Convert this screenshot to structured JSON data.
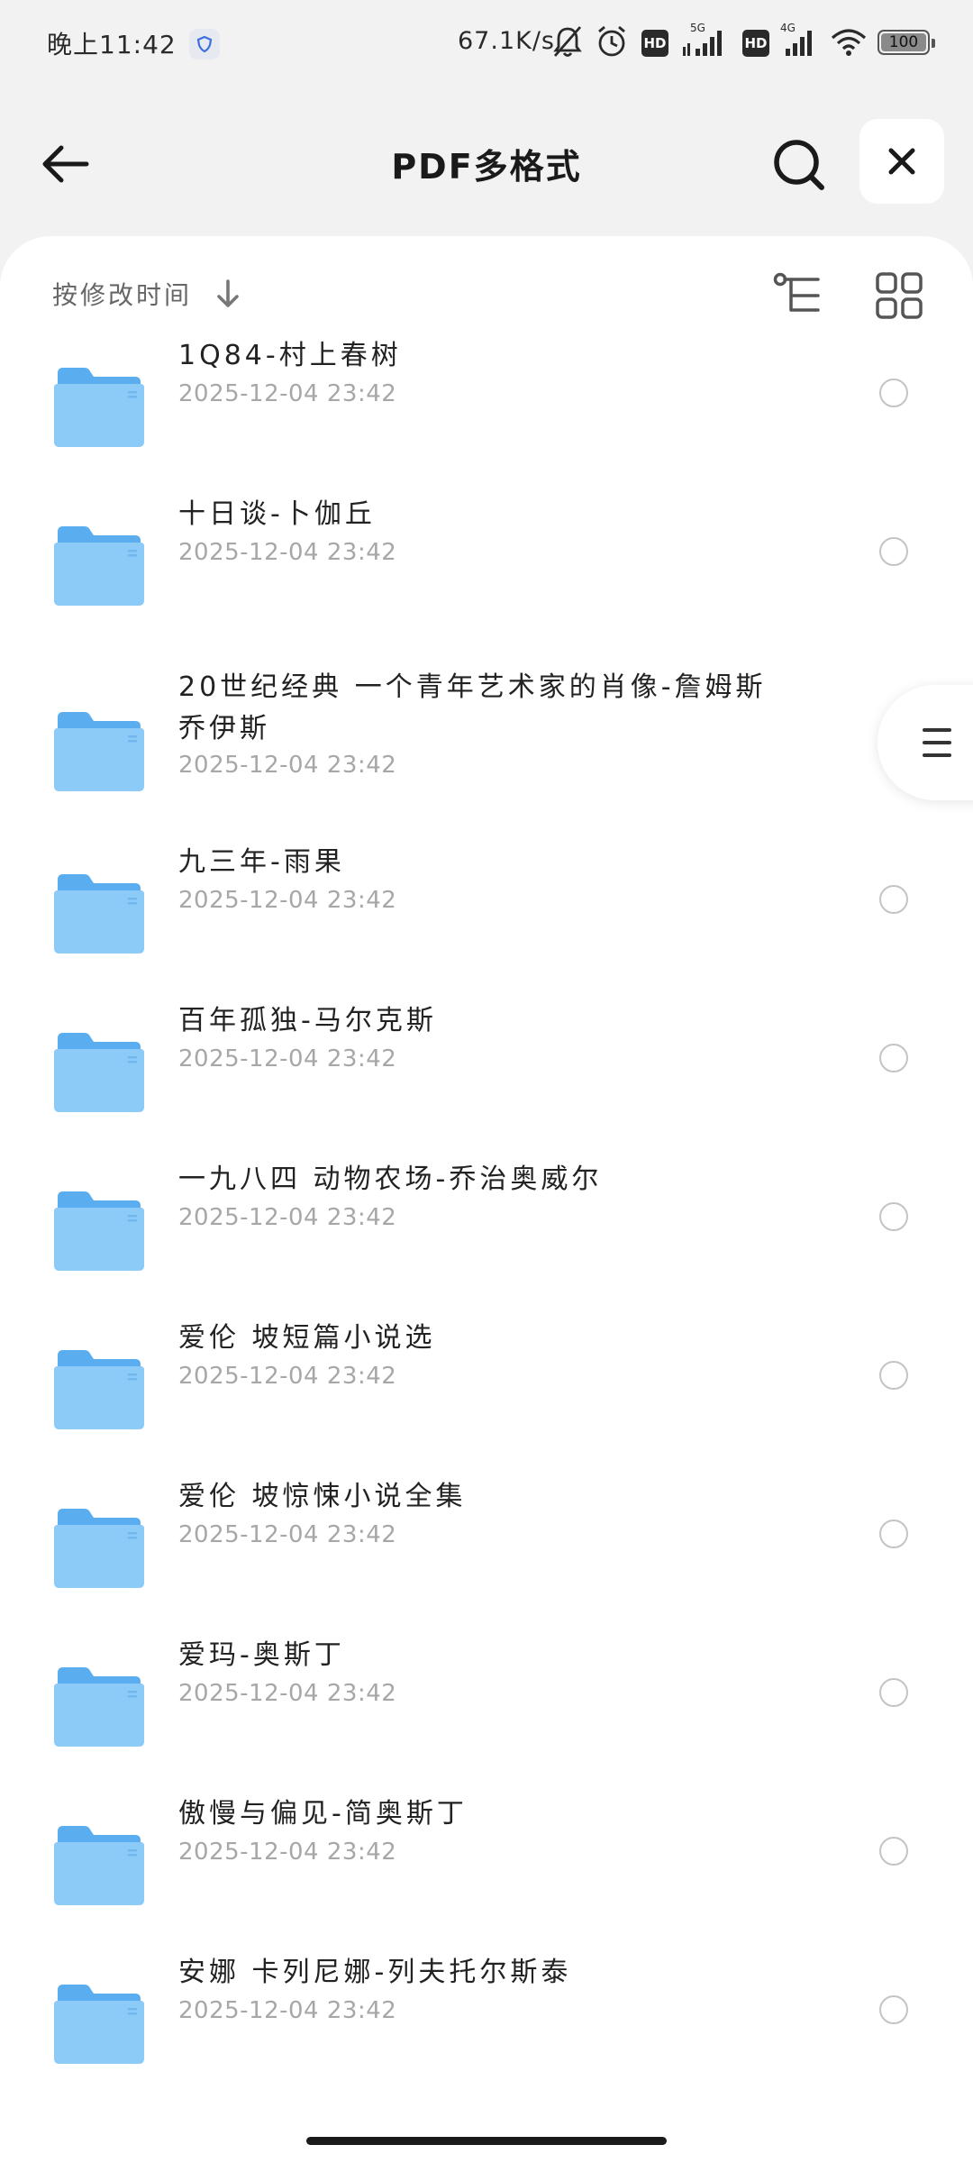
{
  "status_bar": {
    "time": "晚上11:42",
    "net_speed": "67.1K/s",
    "hd1": "HD",
    "net1": "5G",
    "hd2": "HD",
    "net2": "4G",
    "battery": "100"
  },
  "header": {
    "title": "PDF多格式",
    "icons": [
      "back-arrow-icon",
      "search-icon",
      "close-icon"
    ]
  },
  "toolbar": {
    "sort_label": "按修改时间",
    "icons": [
      "sort-down-arrow-icon",
      "tree-view-icon",
      "grid-view-icon"
    ]
  },
  "files": [
    {
      "name": "1Q84-村上春树",
      "date": "2025-12-04 23:42"
    },
    {
      "name": "十日谈-卜伽丘",
      "date": "2025-12-04 23:42"
    },
    {
      "name": "20世纪经典 一个青年艺术家的肖像-詹姆斯乔伊斯",
      "date": "2025-12-04 23:42"
    },
    {
      "name": "九三年-雨果",
      "date": "2025-12-04 23:42"
    },
    {
      "name": "百年孤独-马尔克斯",
      "date": "2025-12-04 23:42"
    },
    {
      "name": "一九八四 动物农场-乔治奥威尔",
      "date": "2025-12-04 23:42"
    },
    {
      "name": "爱伦 坡短篇小说选",
      "date": "2025-12-04 23:42"
    },
    {
      "name": "爱伦 坡惊悚小说全集",
      "date": "2025-12-04 23:42"
    },
    {
      "name": "爱玛-奥斯丁",
      "date": "2025-12-04 23:42"
    },
    {
      "name": "傲慢与偏见-简奥斯丁",
      "date": "2025-12-04 23:42"
    },
    {
      "name": "安娜 卡列尼娜-列夫托尔斯泰",
      "date": "2025-12-04 23:42"
    }
  ],
  "colors": {
    "folder_back": "#5aaef0",
    "folder_front": "#8ccaf7",
    "date_text": "#a7a7a7"
  }
}
